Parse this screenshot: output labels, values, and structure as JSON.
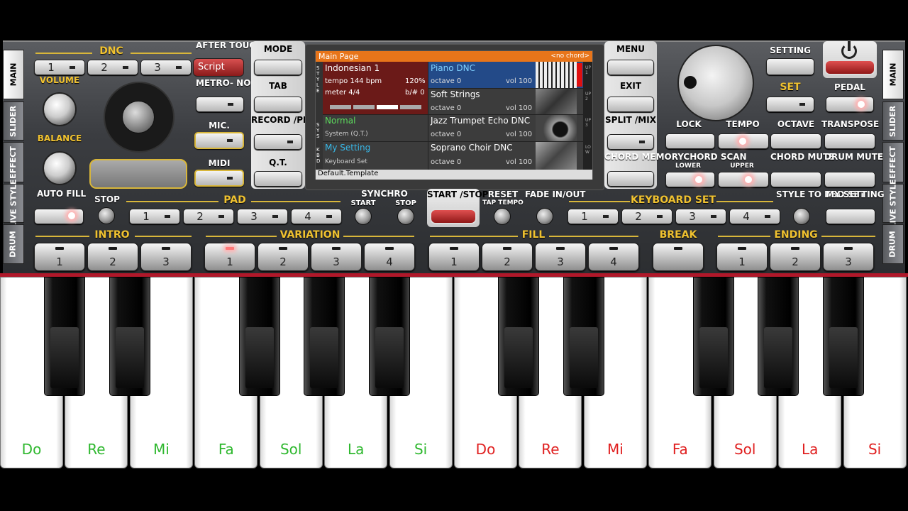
{
  "tabs_left": [
    "MAIN",
    "SLIDER",
    "EFFECT",
    "LIVE STYLE",
    "DRUM"
  ],
  "tabs_right": [
    "MAIN",
    "SLIDER",
    "EFFECT",
    "LIVE STYLE",
    "DRUM"
  ],
  "dnc": {
    "label": "DNC",
    "buttons": [
      "1",
      "2",
      "3"
    ],
    "script": "Script"
  },
  "after_touch": "AFTER TOUCH",
  "volume": "VOLUME",
  "balance": "BALANCE",
  "auto_fill": "AUTO FILL",
  "metronome": "METRO- NOME",
  "mic": "MIC.",
  "midi": "MIDI",
  "mode": "MODE",
  "tab": "TAB",
  "record_play": "RECORD /PLAY",
  "qt": "Q.T.",
  "menu": "MENU",
  "exit": "EXIT",
  "split_mix": "SPLIT /MIX",
  "chord_memory": "CHORD MEMORY",
  "setting": "SETTING",
  "set": "SET",
  "pedal": "PEDAL",
  "lock": "LOCK",
  "tempo": "TEMPO",
  "octave": "OCTAVE",
  "transpose": "TRANSPOSE",
  "chord_scan": "CHORD SCAN",
  "lower": "LOWER",
  "upper": "UPPER",
  "chord_mute": "CHORD MUTE",
  "drum_mute": "DRUM MUTE",
  "stop": "STOP",
  "pad": "PAD",
  "pad_buttons": [
    "1",
    "2",
    "3",
    "4"
  ],
  "synchro": "SYNCHRO",
  "synchro_start": "START",
  "synchro_stop": "STOP",
  "start_stop": "START /STOP",
  "reset": "RESET",
  "tap_tempo": "TAP TEMPO",
  "fade": "FADE IN/OUT",
  "keyboard_set": "KEYBOARD SET",
  "kbd_buttons": [
    "1",
    "2",
    "3",
    "4"
  ],
  "style_to_kbd": "STYLE TO KBD SET",
  "my_setting": "MY SETTING",
  "intro": {
    "label": "INTRO",
    "buttons": [
      "1",
      "2",
      "3"
    ]
  },
  "variation": {
    "label": "VARIATION",
    "buttons": [
      "1",
      "2",
      "3",
      "4"
    ]
  },
  "fill": {
    "label": "FILL",
    "buttons": [
      "1",
      "2",
      "3",
      "4"
    ]
  },
  "break": "BREAK",
  "ending": {
    "label": "ENDING",
    "buttons": [
      "1",
      "2",
      "3"
    ]
  },
  "screen": {
    "title": "Main Page",
    "chord": "<no chord>",
    "style_name": "Indonesian 1",
    "tempo": "tempo 144 bpm",
    "percent": "120%",
    "meter": "meter 4/4",
    "key": "b/# 0",
    "sys_name": "Normal",
    "sys_sub": "System (Q.T.)",
    "kbd_name": "My Setting",
    "kbd_sub": "Keyboard Set",
    "side_style": "STYLE",
    "side_sys": "SYS",
    "side_kbd": "KBD",
    "voices": [
      {
        "name": "Piano DNC",
        "octave": "octave 0",
        "vol": "vol 100",
        "tag": "UP1"
      },
      {
        "name": "Soft Strings",
        "octave": "octave 0",
        "vol": "vol 100",
        "tag": "UP2"
      },
      {
        "name": "Jazz Trumpet Echo DNC",
        "octave": "octave 0",
        "vol": "vol 100",
        "tag": "UP3"
      },
      {
        "name": "Soprano Choir DNC",
        "octave": "octave 0",
        "vol": "vol 100",
        "tag": "LOW"
      }
    ],
    "footer": "Default.Template"
  },
  "keys": [
    "Do",
    "Re",
    "Mi",
    "Fa",
    "Sol",
    "La",
    "Si",
    "Do",
    "Re",
    "Mi",
    "Fa",
    "Sol",
    "La",
    "Si"
  ],
  "colors": {
    "key_green": "#2fb82f",
    "key_red": "#e02020",
    "accent_gold": "#d8b63a",
    "screen_title": "#e8751a"
  }
}
